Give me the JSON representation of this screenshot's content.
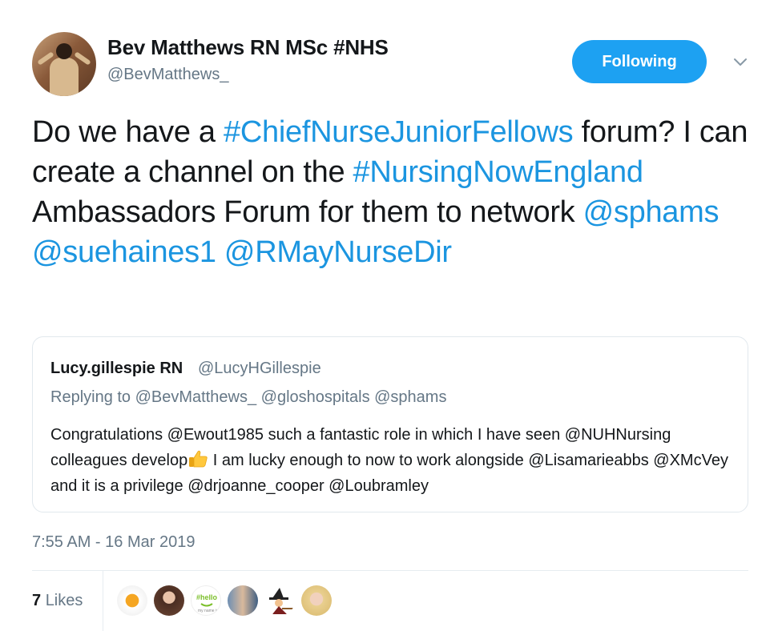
{
  "author": {
    "display_name": "Bev Matthews RN MSc #NHS",
    "handle": "@BevMatthews_"
  },
  "follow_button": "Following",
  "tweet": {
    "segments": [
      {
        "text": "Do we have a ",
        "type": "text"
      },
      {
        "text": "#ChiefNurseJuniorFellows",
        "type": "hashtag"
      },
      {
        "text": " forum? I can create a channel on the ",
        "type": "text"
      },
      {
        "text": "#NursingNowEngland",
        "type": "hashtag"
      },
      {
        "text": " Ambassadors Forum for them to network ",
        "type": "text"
      },
      {
        "text": "@sphams",
        "type": "mention"
      },
      {
        "text": " ",
        "type": "text"
      },
      {
        "text": "@suehaines1",
        "type": "mention"
      },
      {
        "text": " ",
        "type": "text"
      },
      {
        "text": "@RMayNurseDir",
        "type": "mention"
      }
    ]
  },
  "quoted_tweet": {
    "name": "Lucy.gillespie RN",
    "handle": "@LucyHGillespie",
    "replying_label": "Replying to @BevMatthews_ @gloshospitals @sphams",
    "text_before_emoji": "Congratulations @Ewout1985 such a fantastic role in which I have seen @NUHNursing colleagues develop",
    "emoji": "thumbs-up",
    "text_after_emoji": " I am lucky enough to now to work alongside @Lisamarieabbs @XMcVey and it is a privilege @drjoanne_cooper @Loubramley"
  },
  "timestamp": "7:55 AM - 16 Mar 2019",
  "likes": {
    "count": "7",
    "label": "Likes"
  },
  "colors": {
    "link": "#1b95e0",
    "button": "#1da1f2",
    "muted": "#657786"
  }
}
